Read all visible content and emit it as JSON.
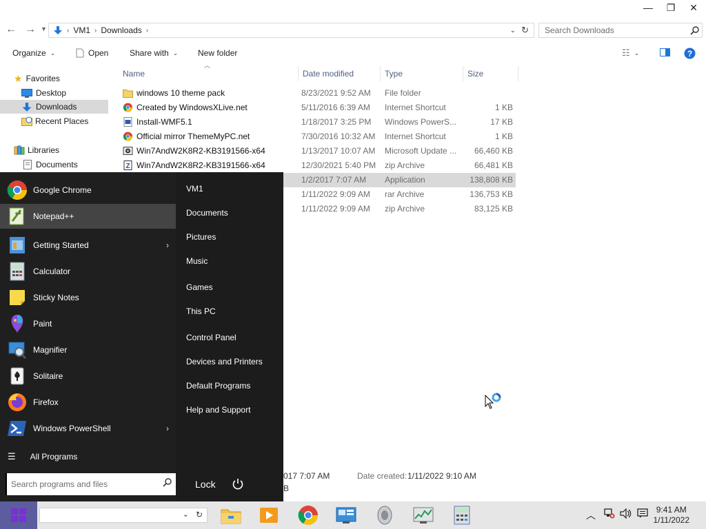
{
  "window": {
    "minimize_glyph": "—",
    "restore_glyph": "❐",
    "close_glyph": "✕"
  },
  "address": {
    "crumbs": [
      "VM1",
      "Downloads"
    ],
    "search_placeholder": "Search Downloads"
  },
  "command_bar": {
    "organize": "Organize",
    "open": "Open",
    "share_with": "Share with",
    "new_folder": "New folder"
  },
  "nav_pane": {
    "favorites": "Favorites",
    "desktop": "Desktop",
    "downloads": "Downloads",
    "recent_places": "Recent Places",
    "libraries": "Libraries",
    "documents": "Documents"
  },
  "columns": {
    "name": "Name",
    "date_modified": "Date modified",
    "type": "Type",
    "size": "Size"
  },
  "files": [
    {
      "name": "windows 10 theme pack",
      "date": "8/23/2021 9:52 AM",
      "type": "File folder",
      "size": "",
      "icon": "folder-icon"
    },
    {
      "name": "Created by WindowsXLive.net",
      "date": "5/11/2016 6:39 AM",
      "type": "Internet Shortcut",
      "size": "1 KB",
      "icon": "chrome-shortcut-icon"
    },
    {
      "name": "Install-WMF5.1",
      "date": "1/18/2017 3:25 PM",
      "type": "Windows PowerS...",
      "size": "17 KB",
      "icon": "powershell-script-icon"
    },
    {
      "name": "Official mirror ThemeMyPC.net",
      "date": "7/30/2016 10:32 AM",
      "type": "Internet Shortcut",
      "size": "1 KB",
      "icon": "chrome-shortcut-icon"
    },
    {
      "name": "Win7AndW2K8R2-KB3191566-x64",
      "date": "1/13/2017 10:07 AM",
      "type": "Microsoft Update ...",
      "size": "66,460 KB",
      "icon": "update-package-icon"
    },
    {
      "name": "Win7AndW2K8R2-KB3191566-x64",
      "date": "12/30/2021 5:40 PM",
      "type": "zip Archive",
      "size": "66,481 KB",
      "icon": "zip-archive-icon"
    },
    {
      "name": "",
      "date": "1/2/2017 7:07 AM",
      "type": "Application",
      "size": "138,808 KB",
      "icon": ""
    },
    {
      "name": "",
      "date": "1/11/2022 9:09 AM",
      "type": "rar Archive",
      "size": "136,753 KB",
      "icon": ""
    },
    {
      "name": "",
      "date": "1/11/2022 9:09 AM",
      "type": "zip Archive",
      "size": "83,125 KB",
      "icon": ""
    }
  ],
  "details_pane": {
    "date_fragment": "017 7:07 AM",
    "size_fragment": "B",
    "date_created_label": "Date created:",
    "date_created_value": "1/11/2022 9:10 AM"
  },
  "start_menu": {
    "programs": [
      {
        "label": "Google Chrome",
        "submenu": false
      },
      {
        "label": "Notepad++",
        "submenu": false
      },
      {
        "label": "Getting Started",
        "submenu": true
      },
      {
        "label": "Calculator",
        "submenu": false
      },
      {
        "label": "Sticky Notes",
        "submenu": false
      },
      {
        "label": "Paint",
        "submenu": false
      },
      {
        "label": "Magnifier",
        "submenu": false
      },
      {
        "label": "Solitaire",
        "submenu": false
      },
      {
        "label": "Firefox",
        "submenu": false
      },
      {
        "label": "Windows PowerShell",
        "submenu": true
      }
    ],
    "all_programs": "All Programs",
    "search_placeholder": "Search programs and files",
    "places": [
      "VM1",
      "Documents",
      "Pictures",
      "Music",
      "Games",
      "This PC",
      "Control Panel",
      "Devices and Printers",
      "Default Programs",
      "Help and Support"
    ],
    "lock_label": "Lock",
    "submenu_arrow": "›"
  },
  "taskbar": {
    "time": "9:41 AM",
    "date": "1/11/2022"
  }
}
